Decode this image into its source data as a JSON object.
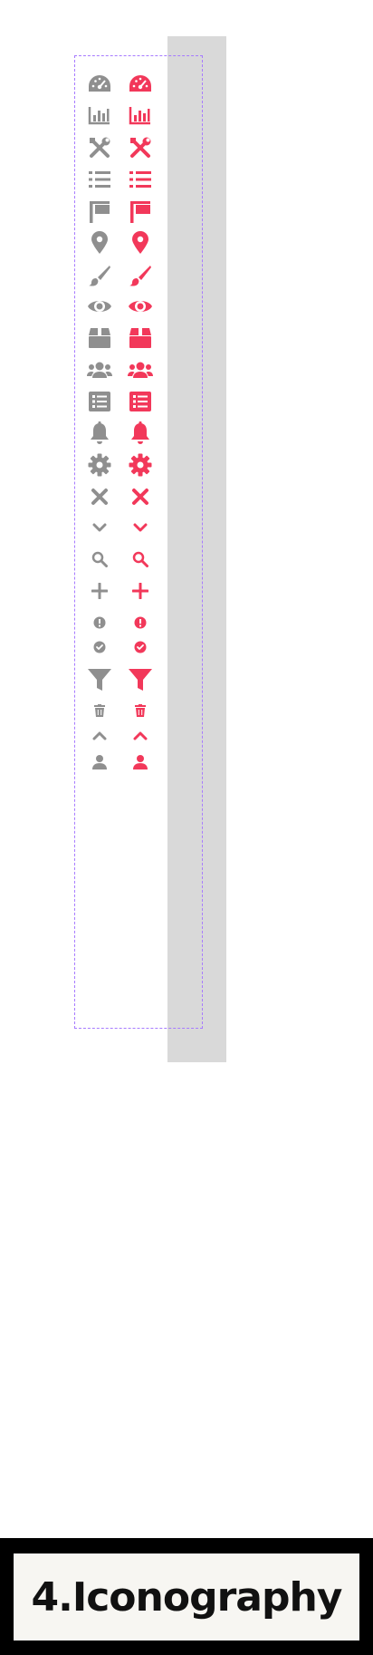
{
  "colors": {
    "inactive": "#8f8f8f",
    "active": "#f2385a",
    "panel": "#d9d9d9",
    "frame": "#a77bff"
  },
  "icons": [
    {
      "name": "dashboard-icon"
    },
    {
      "name": "bar-chart-icon"
    },
    {
      "name": "tools-icon"
    },
    {
      "name": "list-icon"
    },
    {
      "name": "flag-icon"
    },
    {
      "name": "map-pin-icon"
    },
    {
      "name": "paint-brush-icon"
    },
    {
      "name": "eye-icon"
    },
    {
      "name": "box-icon"
    },
    {
      "name": "users-icon"
    },
    {
      "name": "list-card-icon"
    },
    {
      "name": "bell-icon"
    },
    {
      "name": "gear-icon"
    },
    {
      "name": "close-icon"
    },
    {
      "name": "chevron-down-icon"
    },
    {
      "name": "search-icon"
    },
    {
      "name": "plus-icon"
    },
    {
      "name": "alert-circle-icon"
    },
    {
      "name": "check-circle-icon"
    },
    {
      "name": "filter-icon"
    },
    {
      "name": "trash-icon"
    },
    {
      "name": "chevron-up-icon"
    },
    {
      "name": "user-icon"
    }
  ],
  "footer": {
    "title": "4.Iconography"
  }
}
